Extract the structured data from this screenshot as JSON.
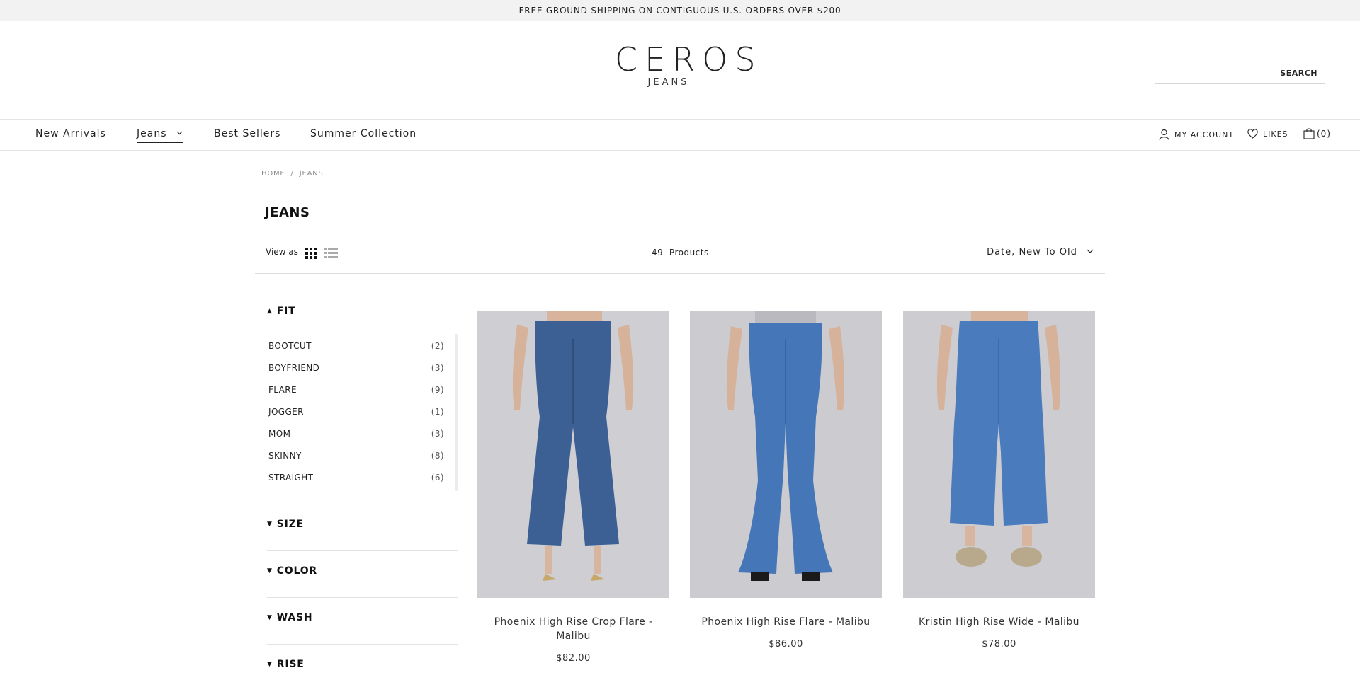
{
  "announcement": "FREE GROUND SHIPPING ON CONTIGUOUS U.S. ORDERS OVER $200",
  "brand": {
    "name": "CEROS",
    "sub": "JEANS"
  },
  "search": {
    "button": "SEARCH",
    "placeholder": ""
  },
  "nav": {
    "items": [
      {
        "label": "New Arrivals"
      },
      {
        "label": "Jeans"
      },
      {
        "label": "Best Sellers"
      },
      {
        "label": "Summer Collection"
      }
    ],
    "account": "MY ACCOUNT",
    "likes": "LIKES",
    "cart": "(0)"
  },
  "breadcrumb": [
    "HOME",
    "/",
    "JEANS"
  ],
  "page_title": "JEANS",
  "toolbar": {
    "view_as": "View as",
    "count": "49",
    "count_label": "Products",
    "sort": "Date, New To Old"
  },
  "filters": {
    "fit": {
      "title": "FIT",
      "options": [
        {
          "label": "BOOTCUT",
          "count": "(2)"
        },
        {
          "label": "BOYFRIEND",
          "count": "(3)"
        },
        {
          "label": "FLARE",
          "count": "(9)"
        },
        {
          "label": "JOGGER",
          "count": "(1)"
        },
        {
          "label": "MOM",
          "count": "(3)"
        },
        {
          "label": "SKINNY",
          "count": "(8)"
        },
        {
          "label": "STRAIGHT",
          "count": "(6)"
        }
      ]
    },
    "size": "SIZE",
    "color": "COLOR",
    "wash": "WASH",
    "rise": "RISE"
  },
  "products": [
    {
      "name": "Phoenix High Rise Crop Flare - Malibu",
      "price": "$82.00"
    },
    {
      "name": "Phoenix High Rise Flare - Malibu",
      "price": "$86.00"
    },
    {
      "name": "Kristin High Rise Wide - Malibu",
      "price": "$78.00"
    }
  ],
  "colors": {
    "announce_bg": "#f2f2f2",
    "text": "#222222",
    "photo_bg": "#cccbd0",
    "denim": "#3f6fae"
  }
}
